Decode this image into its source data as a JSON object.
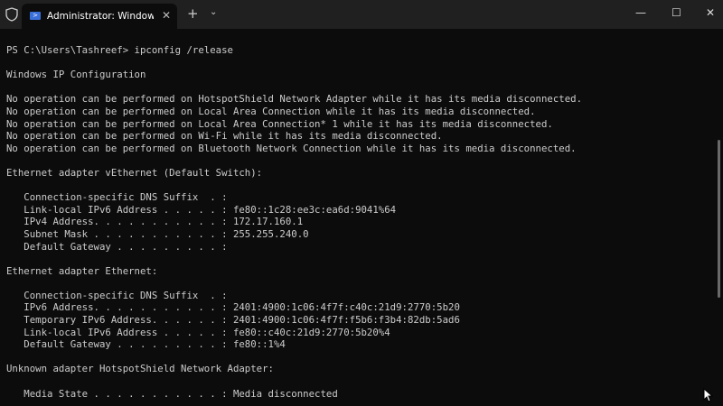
{
  "window": {
    "tab_title": "Administrator: Windows PowerShell",
    "new_tab": "+",
    "dropdown": "⌄",
    "minimize": "—",
    "maximize": "☐",
    "close": "✕",
    "tab_close": "✕"
  },
  "terminal": {
    "lines": [
      "PS C:\\Users\\Tashreef> ipconfig /release",
      "",
      "Windows IP Configuration",
      "",
      "No operation can be performed on HotspotShield Network Adapter while it has its media disconnected.",
      "No operation can be performed on Local Area Connection while it has its media disconnected.",
      "No operation can be performed on Local Area Connection* 1 while it has its media disconnected.",
      "No operation can be performed on Wi-Fi while it has its media disconnected.",
      "No operation can be performed on Bluetooth Network Connection while it has its media disconnected.",
      "",
      "Ethernet adapter vEthernet (Default Switch):",
      "",
      "   Connection-specific DNS Suffix  . :",
      "   Link-local IPv6 Address . . . . . : fe80::1c28:ee3c:ea6d:9041%64",
      "   IPv4 Address. . . . . . . . . . . : 172.17.160.1",
      "   Subnet Mask . . . . . . . . . . . : 255.255.240.0",
      "   Default Gateway . . . . . . . . . :",
      "",
      "Ethernet adapter Ethernet:",
      "",
      "   Connection-specific DNS Suffix  . :",
      "   IPv6 Address. . . . . . . . . . . : 2401:4900:1c06:4f7f:c40c:21d9:2770:5b20",
      "   Temporary IPv6 Address. . . . . . : 2401:4900:1c06:4f7f:f5b6:f3b4:82db:5ad6",
      "   Link-local IPv6 Address . . . . . : fe80::c40c:21d9:2770:5b20%4",
      "   Default Gateway . . . . . . . . . : fe80::1%4",
      "",
      "Unknown adapter HotspotShield Network Adapter:",
      "",
      "   Media State . . . . . . . . . . . : Media disconnected"
    ]
  }
}
